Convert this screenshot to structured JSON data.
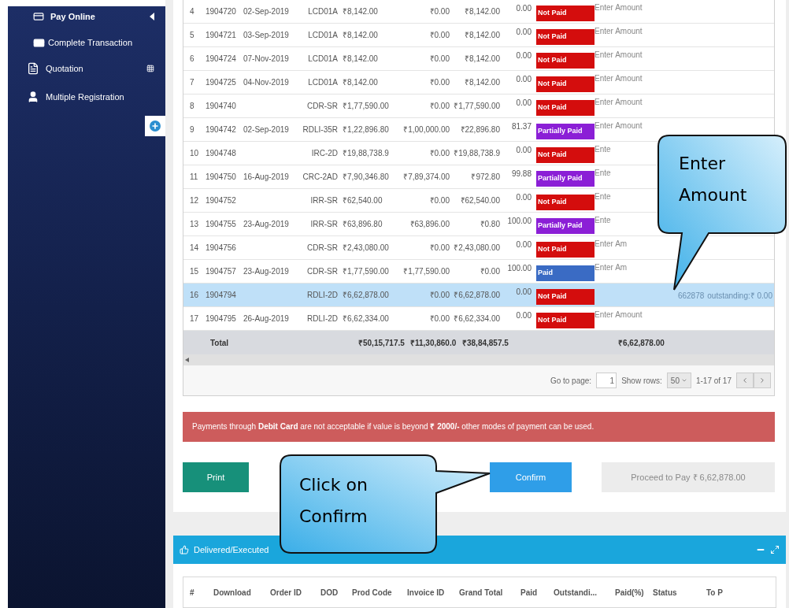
{
  "sidebar": {
    "items": [
      {
        "label": "Pay Online",
        "expanded": true,
        "children": [
          {
            "label": "Complete Transaction"
          }
        ]
      },
      {
        "label": "Quotation"
      },
      {
        "label": "Multiple Registration"
      }
    ]
  },
  "table": {
    "rows": [
      {
        "index": "4",
        "order_id": "1904720",
        "date": "02-Sep-2019",
        "prod_code": "LCD01A",
        "grand_total": "₹8,142.00",
        "paid": "₹0.00",
        "outstanding": "₹8,142.00",
        "paid_pct": "0.00",
        "status": {
          "kind": "not_paid",
          "label": "Not Paid"
        },
        "to_pay": {
          "placeholder": "Enter Amount"
        },
        "selected": false
      },
      {
        "index": "5",
        "order_id": "1904721",
        "date": "03-Sep-2019",
        "prod_code": "LCD01A",
        "grand_total": "₹8,142.00",
        "paid": "₹0.00",
        "outstanding": "₹8,142.00",
        "paid_pct": "0.00",
        "status": {
          "kind": "not_paid",
          "label": "Not Paid"
        },
        "to_pay": {
          "placeholder": "Enter Amount"
        },
        "selected": false
      },
      {
        "index": "6",
        "order_id": "1904724",
        "date": "07-Nov-2019",
        "prod_code": "LCD01A",
        "grand_total": "₹8,142.00",
        "paid": "₹0.00",
        "outstanding": "₹8,142.00",
        "paid_pct": "0.00",
        "status": {
          "kind": "not_paid",
          "label": "Not Paid"
        },
        "to_pay": {
          "placeholder": "Enter Amount"
        },
        "selected": false
      },
      {
        "index": "7",
        "order_id": "1904725",
        "date": "04-Nov-2019",
        "prod_code": "LCD01A",
        "grand_total": "₹8,142.00",
        "paid": "₹0.00",
        "outstanding": "₹8,142.00",
        "paid_pct": "0.00",
        "status": {
          "kind": "not_paid",
          "label": "Not Paid"
        },
        "to_pay": {
          "placeholder": "Enter Amount"
        },
        "selected": false
      },
      {
        "index": "8",
        "order_id": "1904740",
        "prod_code": "CDR-SR",
        "grand_total": "₹1,77,590.00",
        "paid": "₹0.00",
        "outstanding": "₹1,77,590.00",
        "paid_pct": "0.00",
        "status": {
          "kind": "not_paid",
          "label": "Not Paid"
        },
        "to_pay": {
          "placeholder": "Enter Amount"
        },
        "selected": false
      },
      {
        "index": "9",
        "order_id": "1904742",
        "date": "02-Sep-2019",
        "prod_code": "RDLI-35R",
        "grand_total": "₹1,22,896.80",
        "paid": "₹1,00,000.00",
        "outstanding": "₹22,896.80",
        "paid_pct": "81.37",
        "status": {
          "kind": "partial",
          "label": "Partially Paid"
        },
        "to_pay": {
          "placeholder": "Enter Amount"
        },
        "selected": false
      },
      {
        "index": "10",
        "order_id": "1904748",
        "prod_code": "IRC-2D",
        "grand_total": "₹19,88,738.9",
        "paid": "₹0.00",
        "outstanding": "₹19,88,738.9",
        "paid_pct": "0.00",
        "status": {
          "kind": "not_paid",
          "label": "Not Paid"
        },
        "to_pay": {
          "placeholder": "Ente"
        },
        "selected": false
      },
      {
        "index": "11",
        "order_id": "1904750",
        "date": "16-Aug-2019",
        "prod_code": "CRC-2AD",
        "grand_total": "₹7,90,346.80",
        "paid": "₹7,89,374.00",
        "outstanding": "₹972.80",
        "paid_pct": "99.88",
        "status": {
          "kind": "partial",
          "label": "Partially Paid"
        },
        "to_pay": {
          "placeholder": "Ente"
        },
        "selected": false
      },
      {
        "index": "12",
        "order_id": "1904752",
        "prod_code": "IRR-SR",
        "grand_total": "₹62,540.00",
        "paid": "₹0.00",
        "outstanding": "₹62,540.00",
        "paid_pct": "0.00",
        "status": {
          "kind": "not_paid",
          "label": "Not Paid"
        },
        "to_pay": {
          "placeholder": "Ente"
        },
        "selected": false
      },
      {
        "index": "13",
        "order_id": "1904755",
        "date": "23-Aug-2019",
        "prod_code": "IRR-SR",
        "grand_total": "₹63,896.80",
        "paid": "₹63,896.00",
        "outstanding": "₹0.80",
        "paid_pct": "100.00",
        "status": {
          "kind": "partial",
          "label": "Partially Paid"
        },
        "to_pay": {
          "placeholder": "Ente"
        },
        "selected": false
      },
      {
        "index": "14",
        "order_id": "1904756",
        "prod_code": "CDR-SR",
        "grand_total": "₹2,43,080.00",
        "paid": "₹0.00",
        "outstanding": "₹2,43,080.00",
        "paid_pct": "0.00",
        "status": {
          "kind": "not_paid",
          "label": "Not Paid"
        },
        "to_pay": {
          "placeholder": "Enter Am"
        },
        "selected": false
      },
      {
        "index": "15",
        "order_id": "1904757",
        "date": "23-Aug-2019",
        "prod_code": "CDR-SR",
        "grand_total": "₹1,77,590.00",
        "paid": "₹1,77,590.00",
        "outstanding": "₹0.00",
        "paid_pct": "100.00",
        "status": {
          "kind": "paid",
          "label": "Paid"
        },
        "to_pay": {
          "placeholder": "Enter Am"
        },
        "selected": false
      },
      {
        "index": "16",
        "order_id": "1904794",
        "prod_code": "RDLI-2D",
        "grand_total": "₹6,62,878.00",
        "paid": "₹0.00",
        "outstanding": "₹6,62,878.00",
        "paid_pct": "0.00",
        "status": {
          "kind": "not_paid",
          "label": "Not Paid"
        },
        "to_pay": {
          "value": "662878",
          "note": "outstanding:₹ 0.00"
        },
        "selected": true
      },
      {
        "index": "17",
        "order_id": "1904795",
        "date": "26-Aug-2019",
        "prod_code": "RDLI-2D",
        "grand_total": "₹6,62,334.00",
        "paid": "₹0.00",
        "outstanding": "₹6,62,334.00",
        "paid_pct": "0.00",
        "status": {
          "kind": "not_paid",
          "label": "Not Paid"
        },
        "to_pay": {
          "placeholder": "Enter Amount"
        },
        "selected": false
      }
    ],
    "total": {
      "label": "Total",
      "grand_total": "₹50,15,717.5",
      "paid": "₹11,30,860.0",
      "outstanding": "₹38,84,857.5",
      "to_pay": "₹6,62,878.00"
    }
  },
  "pager": {
    "go_to_label": "Go to page:",
    "page": "1",
    "rows_label": "Show rows:",
    "rows": "50",
    "range": "1-17 of 17"
  },
  "alert": "Payments through **Debit Card** are not acceptable if value is beyond **₹ 2000/-** other modes of payment can be used.",
  "buttons": [
    {
      "label": "Print",
      "kind": "print",
      "disabled": false
    },
    {
      "label": "Confirm",
      "kind": "confirm",
      "disabled": false
    },
    {
      "label": "Proceed to Pay ₹ 6,62,878.00",
      "kind": "proceed",
      "disabled": true
    }
  ],
  "delivered_panel": {
    "title": "Delivered/Executed",
    "columns": [
      "#",
      "Download",
      "Order ID",
      "DOD",
      "Prod Code",
      "Invoice ID",
      "Grand Total",
      "Paid",
      "Outstandi...",
      "Paid(%)",
      "Status",
      "To P"
    ]
  },
  "callouts": [
    {
      "text": "Enter Amount",
      "kind": "down"
    },
    {
      "text": "Click on Confirm",
      "kind": "right"
    }
  ]
}
